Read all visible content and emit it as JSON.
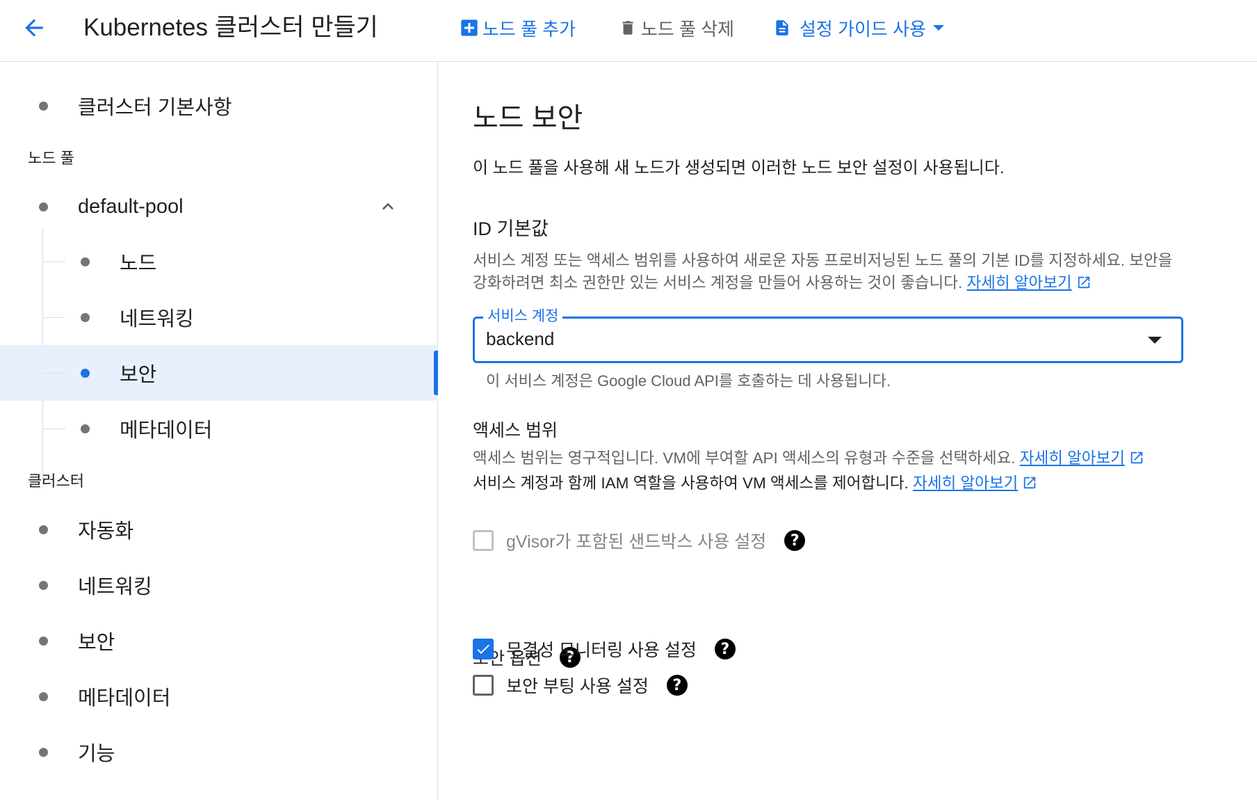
{
  "header": {
    "title": "Kubernetes 클러스터 만들기",
    "add_pool": "노드 풀 추가",
    "delete_pool": "노드 풀 삭제",
    "setup_guide": "설정 가이드 사용"
  },
  "sidebar": {
    "cluster_basics": "클러스터 기본사항",
    "node_pools_section": "노드 풀",
    "pool_name": "default-pool",
    "pool_children": [
      "노드",
      "네트워킹",
      "보안",
      "메타데이터"
    ],
    "cluster_section": "클러스터",
    "cluster_items": [
      "자동화",
      "네트워킹",
      "보안",
      "메타데이터",
      "기능"
    ]
  },
  "main": {
    "title": "노드 보안",
    "description": "이 노드 풀을 사용해 새 노드가 생성되면 이러한 노드 보안 설정이 사용됩니다.",
    "identity": {
      "title": "ID 기본값",
      "text_line1": "서비스 계정 또는 액세스 범위를 사용하여 새로운 자동 프로비저닝된 노드 풀의 기본 ID를 지정하세요. 보안을",
      "text_line2": "강화하려면 최소 권한만 있는 서비스 계정을 만들어 사용하는 것이 좋습니다.",
      "learn_more": "자세히 알아보기"
    },
    "service_account": {
      "label": "서비스 계정",
      "value": "backend",
      "helper": "이 서비스 계정은 Google Cloud API를 호출하는 데 사용됩니다."
    },
    "access_scopes": {
      "title": "액세스 범위",
      "text_line1": "액세스 범위는 영구적입니다. VM에 부여할 API 액세스의 유형과 수준을 선택하세요.",
      "learn_more_1": "자세히 알아보기",
      "text_line2": "서비스 계정과 함께 IAM 역할을 사용하여 VM 액세스를 제어합니다.",
      "learn_more_2": "자세히 알아보기"
    },
    "gvisor": {
      "label": "gVisor가 포함된 샌드박스 사용 설정",
      "checked": false,
      "disabled": true
    },
    "security_options": {
      "title": "보안 옵션",
      "integrity_monitoring": {
        "label": "무결성 모니터링 사용 설정",
        "checked": true
      },
      "secure_boot": {
        "label": "보안 부팅 사용 설정",
        "checked": false
      }
    },
    "help_glyph": "?"
  },
  "colors": {
    "accent": "#1a73e8",
    "active_bg": "#e8f0fe",
    "divider": "#dadce0"
  }
}
